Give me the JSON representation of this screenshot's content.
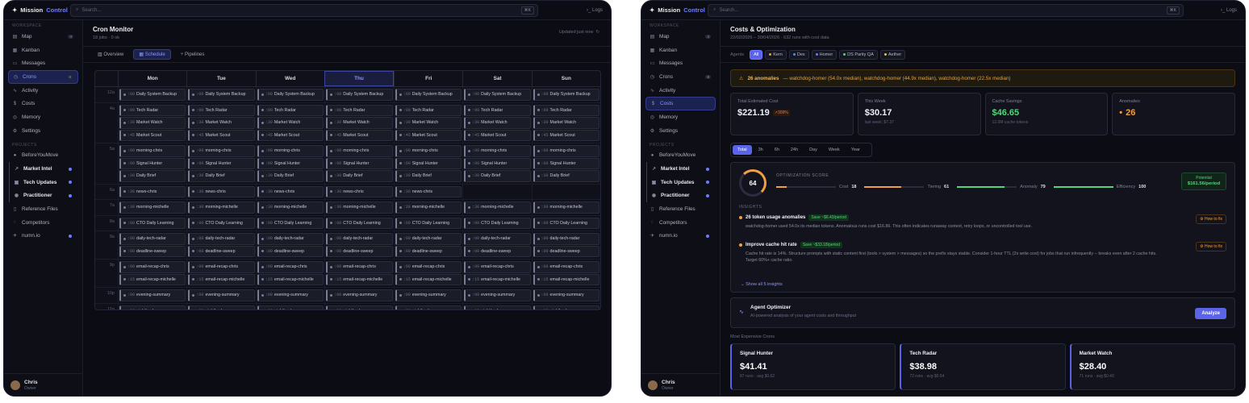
{
  "brand": {
    "name": "Mission",
    "accent": "Control"
  },
  "search": {
    "placeholder": "Search...",
    "kbd": "⌘K"
  },
  "logs": "Logs",
  "workspace_label": "WORKSPACE",
  "projects_label": "PROJECTS",
  "nav": [
    {
      "label": "Map",
      "icon": "map-icon",
      "badge": "4"
    },
    {
      "label": "Kanban",
      "icon": "kanban-icon"
    },
    {
      "label": "Messages",
      "icon": "messages-icon"
    },
    {
      "label": "Crons",
      "icon": "clock-icon",
      "badge": "9"
    },
    {
      "label": "Activity",
      "icon": "activity-icon"
    },
    {
      "label": "Costs",
      "icon": "dollar-icon"
    },
    {
      "label": "Memory",
      "icon": "memory-icon"
    },
    {
      "label": "Settings",
      "icon": "gear-icon"
    }
  ],
  "projects": [
    {
      "label": "BeforeYouMove",
      "icon": "folder-icon"
    },
    {
      "label": "Market Intel",
      "icon": "chart-icon",
      "dot": true
    },
    {
      "label": "Tech Updates",
      "icon": "tech-icon",
      "dot": true
    },
    {
      "label": "Practitioner",
      "icon": "radio-icon",
      "dot": true
    },
    {
      "label": "Reference Files",
      "icon": "file-icon"
    },
    {
      "label": "Competitors",
      "icon": "eye-icon"
    },
    {
      "label": "numn.io",
      "icon": "rocket-icon",
      "dot": true
    }
  ],
  "user": {
    "name": "Chris",
    "role": "Owner"
  },
  "cron": {
    "title": "Cron Monitor",
    "subtitle": "18 jobs · 0 ok",
    "updated": "Updated just now",
    "tabs": [
      "Overview",
      "Schedule",
      "Pipelines"
    ],
    "days": [
      "Mon",
      "Tue",
      "Wed",
      "Thu",
      "Fri",
      "Sat",
      "Sun"
    ],
    "today": "Thu",
    "rows": [
      {
        "time": "12a",
        "jobs": [
          {
            "m": ":00",
            "n": "Daily System Backup"
          }
        ],
        "skip": []
      },
      {
        "time": "4a",
        "jobs": [
          {
            "m": ":00",
            "n": "Tech Radar"
          },
          {
            "m": ":30",
            "n": "Market Watch"
          },
          {
            "m": ":45",
            "n": "Market Scout"
          }
        ],
        "skip": []
      },
      {
        "time": "5a",
        "jobs": [
          {
            "m": ":00",
            "n": "morning-chris"
          },
          {
            "m": ":00",
            "n": "Signal Hunter"
          },
          {
            "m": ":30",
            "n": "Daily Brief"
          }
        ],
        "skip": []
      },
      {
        "time": "6a",
        "jobs": [
          {
            "m": ":30",
            "n": "news-chris"
          }
        ],
        "skip": [
          5,
          6
        ]
      },
      {
        "time": "7a",
        "jobs": [
          {
            "m": ":30",
            "n": "morning-michelle"
          }
        ],
        "skip": []
      },
      {
        "time": "8a",
        "jobs": [
          {
            "m": ":00",
            "n": "CTO Daily Learning"
          }
        ],
        "skip": []
      },
      {
        "time": "9a",
        "jobs": [
          {
            "m": ":00",
            "n": "daily-tech-radar"
          },
          {
            "m": ":00",
            "n": "deadline-sweep"
          }
        ],
        "skip": []
      },
      {
        "time": "9p",
        "jobs": [
          {
            "m": ":00",
            "n": "email-recap-chris"
          },
          {
            "m": ":15",
            "n": "email-recap-michelle"
          }
        ],
        "skip": []
      },
      {
        "time": "10p",
        "jobs": [
          {
            "m": ":00",
            "n": "evening-summary"
          }
        ],
        "skip": []
      },
      {
        "time": "11p",
        "jobs": [
          {
            "m": ":30",
            "n": "nightly-cleanup"
          }
        ],
        "skip": []
      }
    ]
  },
  "costs": {
    "title": "Costs & Optimization",
    "subtitle": "22/02/2026 – 30/04/2026 · 632 runs with cost data",
    "agents_label": "Agents",
    "agents": [
      {
        "label": "All",
        "color": ""
      },
      {
        "label": "Kern",
        "color": "#f0a040"
      },
      {
        "label": "Dex",
        "color": "#5b8af0"
      },
      {
        "label": "Homer",
        "color": "#6e7bff"
      },
      {
        "label": "DS Parity QA",
        "color": "#52d67a"
      },
      {
        "label": "Aether",
        "color": "#e0c060"
      }
    ],
    "anomaly_count": "26 anomalies",
    "anomaly_text": "— watchdog-homer (54.0x median), watchdog-homer (44.9x median), watchdog-homer (22.5x median)",
    "cards": [
      {
        "label": "Total Estimated Cost",
        "value": "$221.19",
        "badge": "↗309%",
        "sub": ""
      },
      {
        "label": "This Week",
        "value": "$30.17",
        "sub": "last week: $7.37"
      },
      {
        "label": "Cache Savings",
        "value": "$46.65",
        "sub": "12.0M cache tokens"
      },
      {
        "label": "Anomalies",
        "value": "26",
        "sub": ""
      }
    ],
    "ranges": [
      "Total",
      "3h",
      "6h",
      "24h",
      "Day",
      "Week",
      "Year"
    ],
    "score": "64",
    "score_label": "OPTIMIZATION SCORE",
    "subscores": [
      {
        "label": "Cost",
        "value": "18",
        "pct": 0.18,
        "color": "#f0a040"
      },
      {
        "label": "Tiering",
        "value": "61",
        "pct": 0.61,
        "color": "#f0a040"
      },
      {
        "label": "Anomaly",
        "value": "79",
        "pct": 0.79,
        "color": "#52d67a"
      },
      {
        "label": "Efficiency",
        "value": "100",
        "pct": 1.0,
        "color": "#52d67a"
      }
    ],
    "potential_label": "Potential",
    "potential_value": "$161.56/period",
    "insights_label": "INSIGHTS",
    "insights": [
      {
        "title": "26 token usage anomalies",
        "save": "Save ~$6.43/period",
        "desc": "watchdog-homer used 54.0x its median tokens. Anomalous runs cost $16.86. This often indicates runaway context, retry loops, or uncontrolled tool use.",
        "fix": "⚙ How to fix"
      },
      {
        "title": "Improve cache hit rate",
        "save": "Save ~$33.18/period",
        "desc": "Cache hit rate is 14%. Structure prompts with static content first (tools > system > messages) so the prefix stays stable. Consider 1-hour TTL (2x write cost) for jobs that run infrequently -- breaks even after 2 cache hits. Target 60%+ cache ratio.",
        "fix": "⚙ How to fix"
      }
    ],
    "show_all": "⌄ Show all 5 insights",
    "agent_title": "Agent Optimizer",
    "agent_sub": "AI-powered analysis of your agent costs and throughput",
    "analyze": "Analyze",
    "expensive_label": "Most Expensive Crons",
    "expensive": [
      {
        "name": "Signal Hunter",
        "value": "$41.41",
        "sub": "87 runs · avg $0.62"
      },
      {
        "name": "Tech Radar",
        "value": "$38.98",
        "sub": "72 runs · avg $0.54"
      },
      {
        "name": "Market Watch",
        "value": "$28.40",
        "sub": "71 runs · avg $0.40"
      }
    ]
  }
}
